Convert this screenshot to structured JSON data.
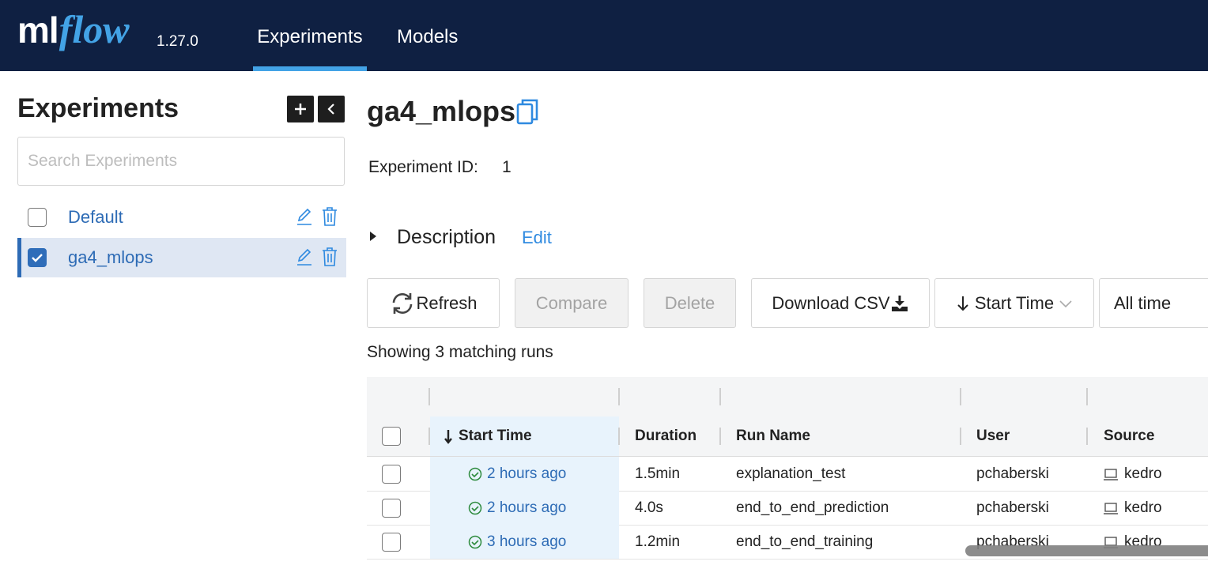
{
  "header": {
    "logo_ml": "ml",
    "logo_flow": "flow",
    "version": "1.27.0",
    "tabs": [
      {
        "label": "Experiments",
        "active": true
      },
      {
        "label": "Models",
        "active": false
      }
    ]
  },
  "sidebar": {
    "title": "Experiments",
    "search_placeholder": "Search Experiments",
    "add_icon": "plus-icon",
    "collapse_icon": "chevron-left-icon",
    "experiments": [
      {
        "name": "Default",
        "checked": false
      },
      {
        "name": "ga4_mlops",
        "checked": true
      }
    ]
  },
  "main": {
    "title": "ga4_mlops",
    "experiment_id_label": "Experiment ID:",
    "experiment_id": "1",
    "description_label": "Description",
    "edit_label": "Edit",
    "buttons": {
      "refresh": "Refresh",
      "compare": "Compare",
      "delete": "Delete",
      "download": "Download CSV",
      "sort": "Start Time",
      "time_filter": "All time"
    },
    "showing": "Showing 3 matching runs",
    "table": {
      "columns": [
        "Start Time",
        "Duration",
        "Run Name",
        "User",
        "Source"
      ],
      "rows": [
        {
          "start": "2 hours ago",
          "duration": "1.5min",
          "run_name": "explanation_test",
          "user": "pchaberski",
          "source": "kedro"
        },
        {
          "start": "2 hours ago",
          "duration": "4.0s",
          "run_name": "end_to_end_prediction",
          "user": "pchaberski",
          "source": "kedro"
        },
        {
          "start": "3 hours ago",
          "duration": "1.2min",
          "run_name": "end_to_end_training",
          "user": "pchaberski",
          "source": "kedro"
        }
      ]
    }
  },
  "colors": {
    "header_bg": "#0f2042",
    "accent": "#43a3e6",
    "link": "#2d6bb5",
    "success": "#2e8b3e"
  }
}
